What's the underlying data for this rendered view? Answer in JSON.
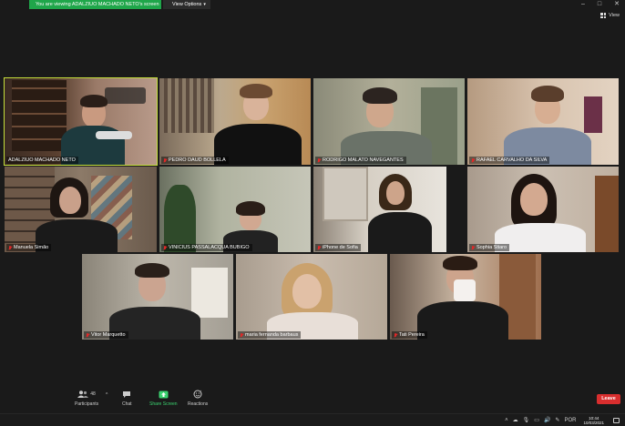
{
  "banner": {
    "text": "You are viewing ADALZIUO MACHADO NETO's screen"
  },
  "view_options": {
    "label": "View Options"
  },
  "window_controls": [
    "–",
    "□",
    "✕"
  ],
  "view_button": {
    "label": "View"
  },
  "participants_tiles": [
    {
      "name": "ADALZIUO MACHADO NETO",
      "muted": false,
      "active": true
    },
    {
      "name": "PEDRO DAUD BOLLELA",
      "muted": true,
      "active": false
    },
    {
      "name": "RODRIGO MALATO NAVEGANTES",
      "muted": true,
      "active": false
    },
    {
      "name": "RAFAEL CARVALHO DA SILVA",
      "muted": true,
      "active": false
    },
    {
      "name": "Manuela Simão",
      "muted": true,
      "active": false
    },
    {
      "name": "VINICIUS PASSALACQUA BUBIGO",
      "muted": true,
      "active": false
    },
    {
      "name": "iPhone de Sofia",
      "muted": true,
      "active": false
    },
    {
      "name": "Sophia Stiaro",
      "muted": true,
      "active": false
    },
    {
      "name": "Vitor Marquetto",
      "muted": true,
      "active": false
    },
    {
      "name": "maria fernanda barbaus",
      "muted": true,
      "active": false
    },
    {
      "name": "Tati Pereira",
      "muted": true,
      "active": false
    }
  ],
  "toolbar": {
    "participants_label": "Participants",
    "participants_count": "48",
    "chat_label": "Chat",
    "share_screen_label": "Share Screen",
    "reactions_label": "Reactions",
    "leave_label": "Leave"
  },
  "taskbar": {
    "language": "POR",
    "time": "10:44",
    "date": "10/03/2021"
  },
  "colors": {
    "active_speaker": "#c6e03b",
    "share_green": "#1fa64a",
    "leave_red": "#d92e2e",
    "mic_muted": "#e02828"
  }
}
